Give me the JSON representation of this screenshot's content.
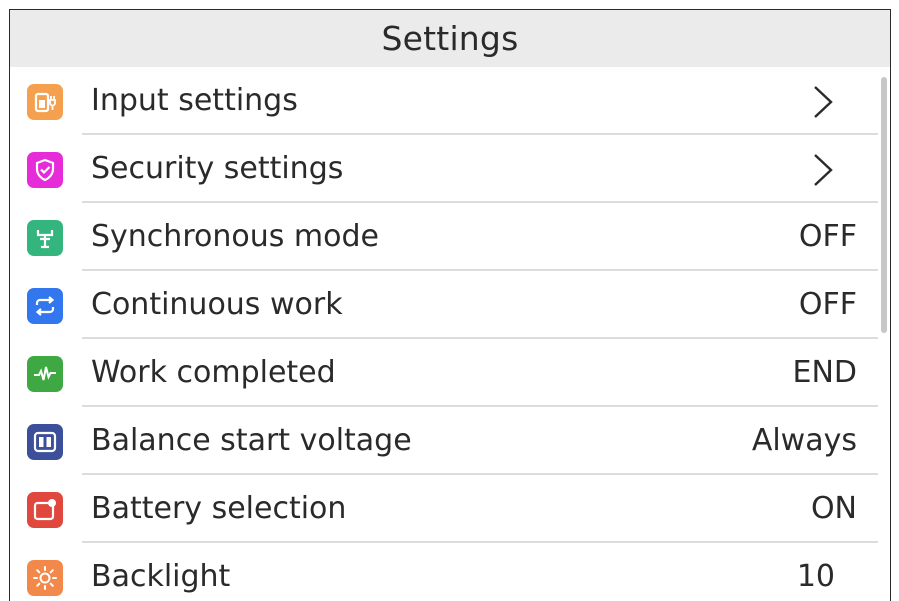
{
  "header": {
    "title": "Settings"
  },
  "items": [
    {
      "label": "Input settings",
      "value": "",
      "type": "submenu",
      "icon": "power-input-icon",
      "color": "#F4A04E"
    },
    {
      "label": "Security settings",
      "value": "",
      "type": "submenu",
      "icon": "shield-icon",
      "color": "#E62BD8"
    },
    {
      "label": "Synchronous mode",
      "value": "OFF",
      "type": "value",
      "icon": "sync-fork-icon",
      "color": "#35B57E"
    },
    {
      "label": "Continuous work",
      "value": "OFF",
      "type": "value",
      "icon": "repeat-icon",
      "color": "#3277EE"
    },
    {
      "label": "Work completed",
      "value": "END",
      "type": "value",
      "icon": "pulse-icon",
      "color": "#3EA843"
    },
    {
      "label": "Balance start voltage",
      "value": "Always",
      "type": "value",
      "icon": "battery-cells-icon",
      "color": "#3B4F9B"
    },
    {
      "label": "Battery selection",
      "value": "ON",
      "type": "value",
      "icon": "battery-select-icon",
      "color": "#E0473D"
    },
    {
      "label": "Backlight",
      "value": "10",
      "type": "value",
      "icon": "sun-icon",
      "color": "#F2884A"
    }
  ]
}
